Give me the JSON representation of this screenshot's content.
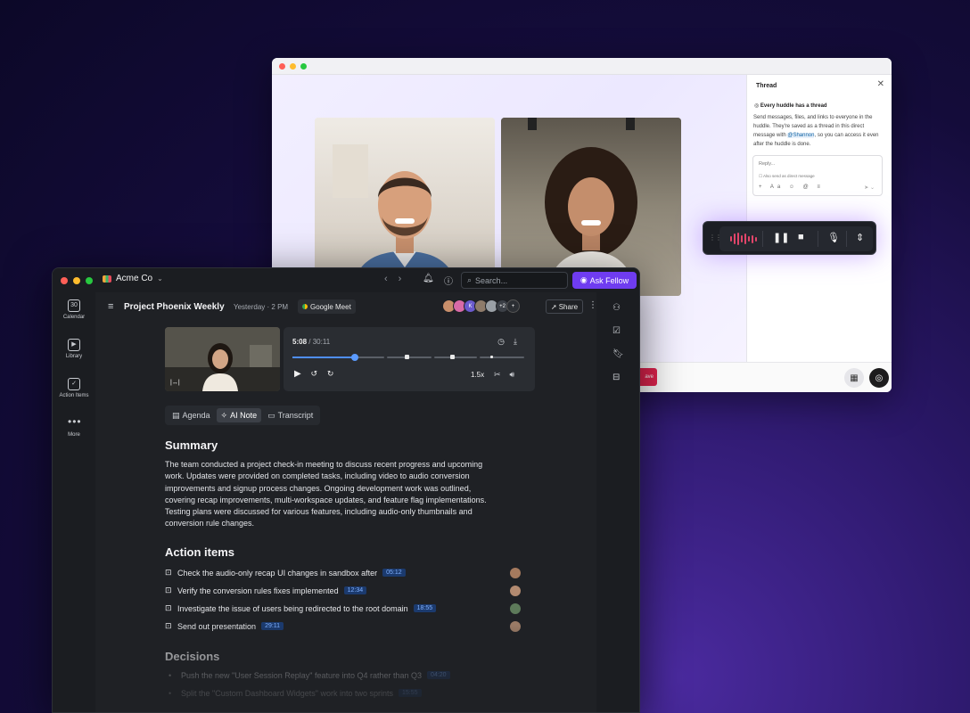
{
  "call_window": {
    "thread": {
      "title": "Thread",
      "close": "✕",
      "subtitle": "Every huddle has a thread",
      "body_before": "Send messages, files, and links to everyone in the huddle. They're saved as a thread in this direct message with ",
      "mention": "@Shannon",
      "body_after": ", so you can access it even after the huddle is done.",
      "reply_placeholder": "Reply...",
      "also_send": "Also send as direct message",
      "tools": "+ Aa ☺ @ ≡"
    },
    "footer": {
      "leave_label": "ave"
    }
  },
  "fellow": {
    "org_name": "Acme Co",
    "search_placeholder": "Search...",
    "ask_button": "Ask Fellow",
    "rail": [
      {
        "label": "Calendar",
        "icon": "30"
      },
      {
        "label": "Library",
        "icon": "▶"
      },
      {
        "label": "Action Items",
        "icon": "✓"
      },
      {
        "label": "More",
        "icon": "•••"
      }
    ],
    "meeting": {
      "title": "Project Phoenix Weekly",
      "time": "Yesterday · 2 PM",
      "platform": "Google Meet",
      "extra_participants": "+2",
      "share_label": "Share",
      "avatar_letter": "K"
    },
    "player": {
      "current": "5:08",
      "separator": "/",
      "total": "30:11",
      "speed": "1.5x",
      "progress_fraction": 0.17
    },
    "tabs": [
      {
        "label": "Agenda",
        "icon": "▤",
        "active": false
      },
      {
        "label": "AI Note",
        "icon": "✧",
        "active": true
      },
      {
        "label": "Transcript",
        "icon": "▭",
        "active": false
      }
    ],
    "summary": {
      "heading": "Summary",
      "text": "The team conducted a project check-in meeting to discuss recent progress and upcoming work. Updates were provided on completed tasks, including video to audio conversion improvements and signup process changes. Ongoing development work was outlined, covering recap improvements, multi-workspace updates, and feature flag implementations. Testing plans were discussed for various features, including audio-only thumbnails and conversion rule changes."
    },
    "action_items": {
      "heading": "Action items",
      "items": [
        {
          "text": "Check the audio-only recap UI changes in sandbox after",
          "ts": "05:12"
        },
        {
          "text": "Verify the conversion rules fixes implemented",
          "ts": "12:34"
        },
        {
          "text": "Investigate the issue of users being redirected to the root domain",
          "ts": "18:55"
        },
        {
          "text": "Send out presentation",
          "ts": "29:11"
        }
      ]
    },
    "decisions": {
      "heading": "Decisions",
      "items": [
        {
          "text": "Push the new \"User Session Replay\" feature into Q4 rather than Q3",
          "ts": "04:20"
        },
        {
          "text": "Split the \"Custom Dashboard Widgets\" work into two sprints",
          "ts": "15:55"
        }
      ]
    }
  }
}
